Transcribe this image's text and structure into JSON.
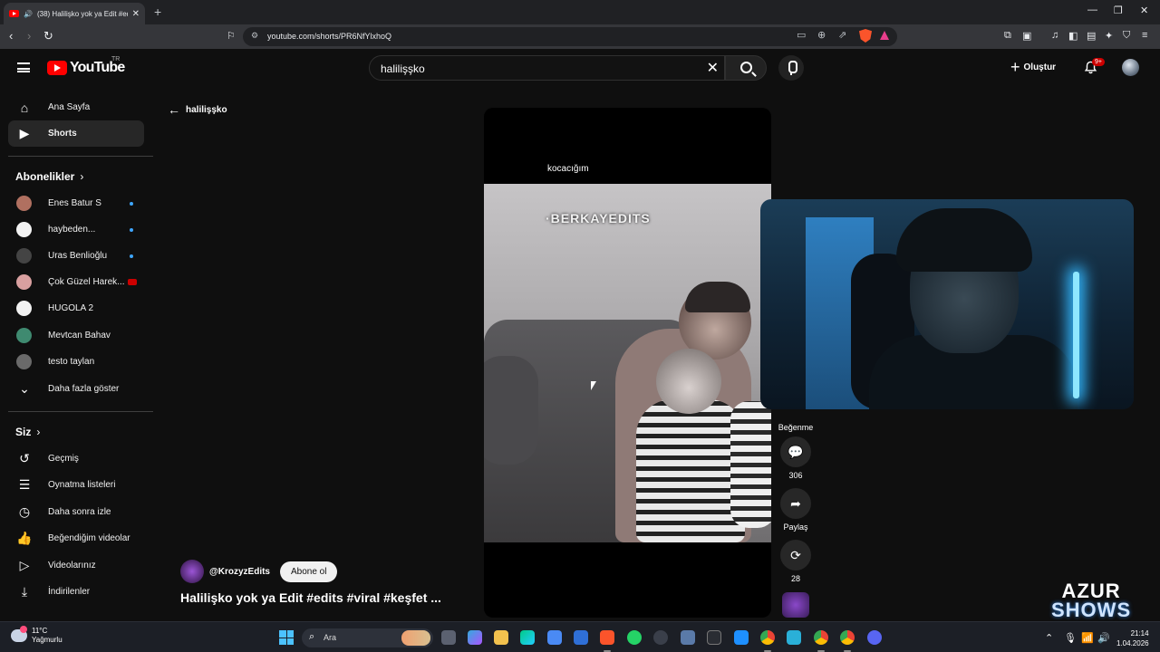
{
  "browser": {
    "tab_title": "(38) Halilişko yok ya Edit #edits",
    "new_tab": "+",
    "close": "✕",
    "window_controls": [
      "—",
      "❐",
      "✕"
    ],
    "url": "youtube.com/shorts/PR6NfYlxhoQ"
  },
  "header": {
    "logo_text": "YouTube",
    "country_code": "TR",
    "search_value": "halilişşko",
    "search_clear": "✕",
    "create_label": "Oluştur",
    "notifications_badge": "9+"
  },
  "sidebar": {
    "main": [
      {
        "label": "Ana Sayfa",
        "icon": "home-icon",
        "glyph": "⌂"
      },
      {
        "label": "Shorts",
        "icon": "shorts-icon",
        "glyph": "▶"
      }
    ],
    "subscriptions_title": "Abonelikler",
    "subscriptions": [
      {
        "label": "Enes Batur S",
        "color": "#b07060"
      },
      {
        "label": "haybeden...",
        "color": "#f2f2f2"
      },
      {
        "label": "Uras Benlioğlu",
        "color": "#444444"
      },
      {
        "label": "Çok Güzel Harek...",
        "color": "#d9a0a0"
      },
      {
        "label": "HUGOLA 2",
        "color": "#f1f1f1"
      },
      {
        "label": "Mevtcan Bahav",
        "color": "#3f8a70"
      },
      {
        "label": "testo taylan",
        "color": "#6a6a6a"
      }
    ],
    "show_more": "Daha fazla göster",
    "you_title": "Siz",
    "you_items": [
      {
        "label": "Geçmiş",
        "glyph": "↺"
      },
      {
        "label": "Oynatma listeleri",
        "glyph": "☰"
      },
      {
        "label": "Daha sonra izle",
        "glyph": "◷"
      },
      {
        "label": "Beğendiğim videolar",
        "glyph": "👍"
      },
      {
        "label": "Videolarınız",
        "glyph": "▷"
      },
      {
        "label": "İndirilenler",
        "glyph": "⤓"
      }
    ]
  },
  "main": {
    "back_label": "halilişşko",
    "caption": "kocacığım",
    "watermark": "·BERKAYEDITS",
    "channel_name": "@KrozyzEdits",
    "subscribe_label": "Abone ol",
    "video_title": "Halilişko yok ya Edit #edits #viral #keşfet ...",
    "actions": {
      "dislike_label": "Beğenme",
      "comments_count": "306",
      "share_label": "Paylaş",
      "remix_count": "28"
    }
  },
  "overlay": {
    "brand_line1": "AZUR",
    "brand_line2": "SHOWS"
  },
  "taskbar": {
    "temperature": "11°C",
    "weather": "Yağmurlu",
    "search_placeholder": "Ara",
    "time": "21:14",
    "date": "1.04.2026"
  }
}
